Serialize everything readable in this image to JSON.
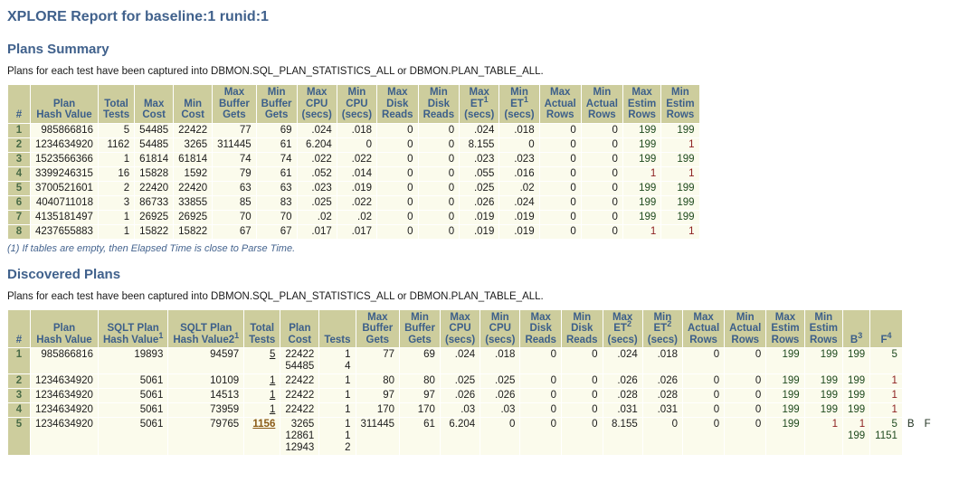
{
  "report": {
    "title": "XPLORE Report for baseline:1 runid:1"
  },
  "plans_summary": {
    "heading": "Plans Summary",
    "description": "Plans for each test have been captured into DBMON.SQL_PLAN_STATISTICS_ALL or DBMON.PLAN_TABLE_ALL.",
    "footnote": "(1) If tables are empty, then Elapsed Time is close to Parse Time.",
    "columns": [
      {
        "line1": "",
        "line2": "",
        "line3": "#"
      },
      {
        "line1": "",
        "line2": "Plan",
        "line3": "Hash Value"
      },
      {
        "line1": "",
        "line2": "Total",
        "line3": "Tests"
      },
      {
        "line1": "",
        "line2": "Max",
        "line3": "Cost"
      },
      {
        "line1": "",
        "line2": "Min",
        "line3": "Cost"
      },
      {
        "line1": "Max",
        "line2": "Buffer",
        "line3": "Gets"
      },
      {
        "line1": "Min",
        "line2": "Buffer",
        "line3": "Gets"
      },
      {
        "line1": "Max",
        "line2": "CPU",
        "line3": "(secs)"
      },
      {
        "line1": "Min",
        "line2": "CPU",
        "line3": "(secs)"
      },
      {
        "line1": "Max",
        "line2": "Disk",
        "line3": "Reads"
      },
      {
        "line1": "Min",
        "line2": "Disk",
        "line3": "Reads"
      },
      {
        "line1": "Max",
        "line2": "ET",
        "line2sup": "1",
        "line3": "(secs)"
      },
      {
        "line1": "Min",
        "line2": "ET",
        "line2sup": "1",
        "line3": "(secs)"
      },
      {
        "line1": "Max",
        "line2": "Actual",
        "line3": "Rows"
      },
      {
        "line1": "Min",
        "line2": "Actual",
        "line3": "Rows"
      },
      {
        "line1": "Max",
        "line2": "Estim",
        "line3": "Rows"
      },
      {
        "line1": "Min",
        "line2": "Estim",
        "line3": "Rows"
      }
    ],
    "rows": [
      {
        "idx": "1",
        "cells": [
          "985866816",
          "5",
          "54485",
          "22422",
          "77",
          "69",
          ".024",
          ".018",
          "0",
          "0",
          ".024",
          ".018",
          "0",
          "0",
          "199",
          "199"
        ]
      },
      {
        "idx": "2",
        "cells": [
          "1234634920",
          "1162",
          "54485",
          "3265",
          "311445",
          "61",
          "6.204",
          "0",
          "0",
          "0",
          "8.155",
          "0",
          "0",
          "0",
          "199",
          "1"
        ]
      },
      {
        "idx": "3",
        "cells": [
          "1523566366",
          "1",
          "61814",
          "61814",
          "74",
          "74",
          ".022",
          ".022",
          "0",
          "0",
          ".023",
          ".023",
          "0",
          "0",
          "199",
          "199"
        ]
      },
      {
        "idx": "4",
        "cells": [
          "3399246315",
          "16",
          "15828",
          "1592",
          "79",
          "61",
          ".052",
          ".014",
          "0",
          "0",
          ".055",
          ".016",
          "0",
          "0",
          "1",
          "1"
        ]
      },
      {
        "idx": "5",
        "cells": [
          "3700521601",
          "2",
          "22420",
          "22420",
          "63",
          "63",
          ".023",
          ".019",
          "0",
          "0",
          ".025",
          ".02",
          "0",
          "0",
          "199",
          "199"
        ]
      },
      {
        "idx": "6",
        "cells": [
          "4040711018",
          "3",
          "86733",
          "33855",
          "85",
          "83",
          ".025",
          ".022",
          "0",
          "0",
          ".026",
          ".024",
          "0",
          "0",
          "199",
          "199"
        ]
      },
      {
        "idx": "7",
        "cells": [
          "4135181497",
          "1",
          "26925",
          "26925",
          "70",
          "70",
          ".02",
          ".02",
          "0",
          "0",
          ".019",
          ".019",
          "0",
          "0",
          "199",
          "199"
        ]
      },
      {
        "idx": "8",
        "cells": [
          "4237655883",
          "1",
          "15822",
          "15822",
          "67",
          "67",
          ".017",
          ".017",
          "0",
          "0",
          ".019",
          ".019",
          "0",
          "0",
          "1",
          "1"
        ]
      }
    ]
  },
  "discovered_plans": {
    "heading": "Discovered Plans",
    "description": "Plans for each test have been captured into DBMON.SQL_PLAN_STATISTICS_ALL or DBMON.PLAN_TABLE_ALL.",
    "columns": [
      {
        "line1": "",
        "line2": "",
        "line3": "#"
      },
      {
        "line1": "",
        "line2": "Plan",
        "line3": "Hash Value"
      },
      {
        "line1": "",
        "line2": "SQLT Plan",
        "line3": "Hash Value",
        "line3sup": "1"
      },
      {
        "line1": "",
        "line2": "SQLT Plan",
        "line3": "Hash Value2",
        "line3sup": "1"
      },
      {
        "line1": "",
        "line2": "Total",
        "line3": "Tests"
      },
      {
        "line1": "",
        "line2": "Plan",
        "line3": "Cost"
      },
      {
        "line1": "",
        "line2": "",
        "line3": "Tests"
      },
      {
        "line1": "Max",
        "line2": "Buffer",
        "line3": "Gets"
      },
      {
        "line1": "Min",
        "line2": "Buffer",
        "line3": "Gets"
      },
      {
        "line1": "Max",
        "line2": "CPU",
        "line3": "(secs)"
      },
      {
        "line1": "Min",
        "line2": "CPU",
        "line3": "(secs)"
      },
      {
        "line1": "Max",
        "line2": "Disk",
        "line3": "Reads"
      },
      {
        "line1": "Min",
        "line2": "Disk",
        "line3": "Reads"
      },
      {
        "line1": "Max",
        "line2": "ET",
        "line2sup": "2",
        "line3": "(secs)"
      },
      {
        "line1": "Min",
        "line2": "ET",
        "line2sup": "2",
        "line3": "(secs)"
      },
      {
        "line1": "Max",
        "line2": "Actual",
        "line3": "Rows"
      },
      {
        "line1": "Min",
        "line2": "Actual",
        "line3": "Rows"
      },
      {
        "line1": "Max",
        "line2": "Estim",
        "line3": "Rows"
      },
      {
        "line1": "Min",
        "line2": "Estim",
        "line3": "Rows"
      },
      {
        "line1": "",
        "line2": "",
        "line3": "B",
        "line3sup": "3"
      },
      {
        "line1": "",
        "line2": "",
        "line3": "F",
        "line3sup": "4"
      }
    ],
    "rows": [
      {
        "idx": "1",
        "plan_hash_value": "985866816",
        "sqlt_plan_hash_value": "19893",
        "sqlt_plan_hash_value2": "94597",
        "total_tests": "5",
        "plan_cost": [
          "22422",
          "54485"
        ],
        "tests": [
          "1",
          "4"
        ],
        "max_buffer_gets": "77",
        "min_buffer_gets": "69",
        "max_cpu": ".024",
        "min_cpu": ".018",
        "max_disk_reads": "0",
        "min_disk_reads": "0",
        "max_et": ".024",
        "min_et": ".018",
        "max_actual_rows": "0",
        "min_actual_rows": "0",
        "max_estim_rows": "199",
        "min_estim_rows": "199",
        "b": [
          "199"
        ],
        "f": [
          "5"
        ]
      },
      {
        "idx": "2",
        "plan_hash_value": "1234634920",
        "sqlt_plan_hash_value": "5061",
        "sqlt_plan_hash_value2": "10109",
        "total_tests": "1",
        "plan_cost": [
          "22422"
        ],
        "tests": [
          "1"
        ],
        "max_buffer_gets": "80",
        "min_buffer_gets": "80",
        "max_cpu": ".025",
        "min_cpu": ".025",
        "max_disk_reads": "0",
        "min_disk_reads": "0",
        "max_et": ".026",
        "min_et": ".026",
        "max_actual_rows": "0",
        "min_actual_rows": "0",
        "max_estim_rows": "199",
        "min_estim_rows": "199",
        "b": [
          "199"
        ],
        "f": [
          "1"
        ]
      },
      {
        "idx": "3",
        "plan_hash_value": "1234634920",
        "sqlt_plan_hash_value": "5061",
        "sqlt_plan_hash_value2": "14513",
        "total_tests": "1",
        "plan_cost": [
          "22422"
        ],
        "tests": [
          "1"
        ],
        "max_buffer_gets": "97",
        "min_buffer_gets": "97",
        "max_cpu": ".026",
        "min_cpu": ".026",
        "max_disk_reads": "0",
        "min_disk_reads": "0",
        "max_et": ".028",
        "min_et": ".028",
        "max_actual_rows": "0",
        "min_actual_rows": "0",
        "max_estim_rows": "199",
        "min_estim_rows": "199",
        "b": [
          "199"
        ],
        "f": [
          "1"
        ]
      },
      {
        "idx": "4",
        "plan_hash_value": "1234634920",
        "sqlt_plan_hash_value": "5061",
        "sqlt_plan_hash_value2": "73959",
        "total_tests": "1",
        "plan_cost": [
          "22422"
        ],
        "tests": [
          "1"
        ],
        "max_buffer_gets": "170",
        "min_buffer_gets": "170",
        "max_cpu": ".03",
        "min_cpu": ".03",
        "max_disk_reads": "0",
        "min_disk_reads": "0",
        "max_et": ".031",
        "min_et": ".031",
        "max_actual_rows": "0",
        "min_actual_rows": "0",
        "max_estim_rows": "199",
        "min_estim_rows": "199",
        "b": [
          "199"
        ],
        "f": [
          "1"
        ]
      },
      {
        "idx": "5",
        "plan_hash_value": "1234634920",
        "sqlt_plan_hash_value": "5061",
        "sqlt_plan_hash_value2": "79765",
        "total_tests": "1156",
        "plan_cost": [
          "3265",
          "12861",
          "12943"
        ],
        "tests": [
          "1",
          "1",
          "2"
        ],
        "max_buffer_gets": "311445",
        "min_buffer_gets": "61",
        "max_cpu": "6.204",
        "min_cpu": "0",
        "max_disk_reads": "0",
        "min_disk_reads": "0",
        "max_et": "8.155",
        "min_et": "0",
        "max_actual_rows": "0",
        "min_actual_rows": "0",
        "max_estim_rows": "199",
        "min_estim_rows": "1",
        "b": [
          "1",
          "199"
        ],
        "f": [
          "5",
          "1151"
        ],
        "flag_b": "B",
        "flag_f": "F"
      }
    ]
  },
  "colors": {
    "heading": "#40618c",
    "header_bg": "#cdcd9d",
    "row_bg": "#fbfbec",
    "green_value": "#1f4a1f",
    "red_value": "#8d2020",
    "orange_link": "#8a5a16"
  }
}
